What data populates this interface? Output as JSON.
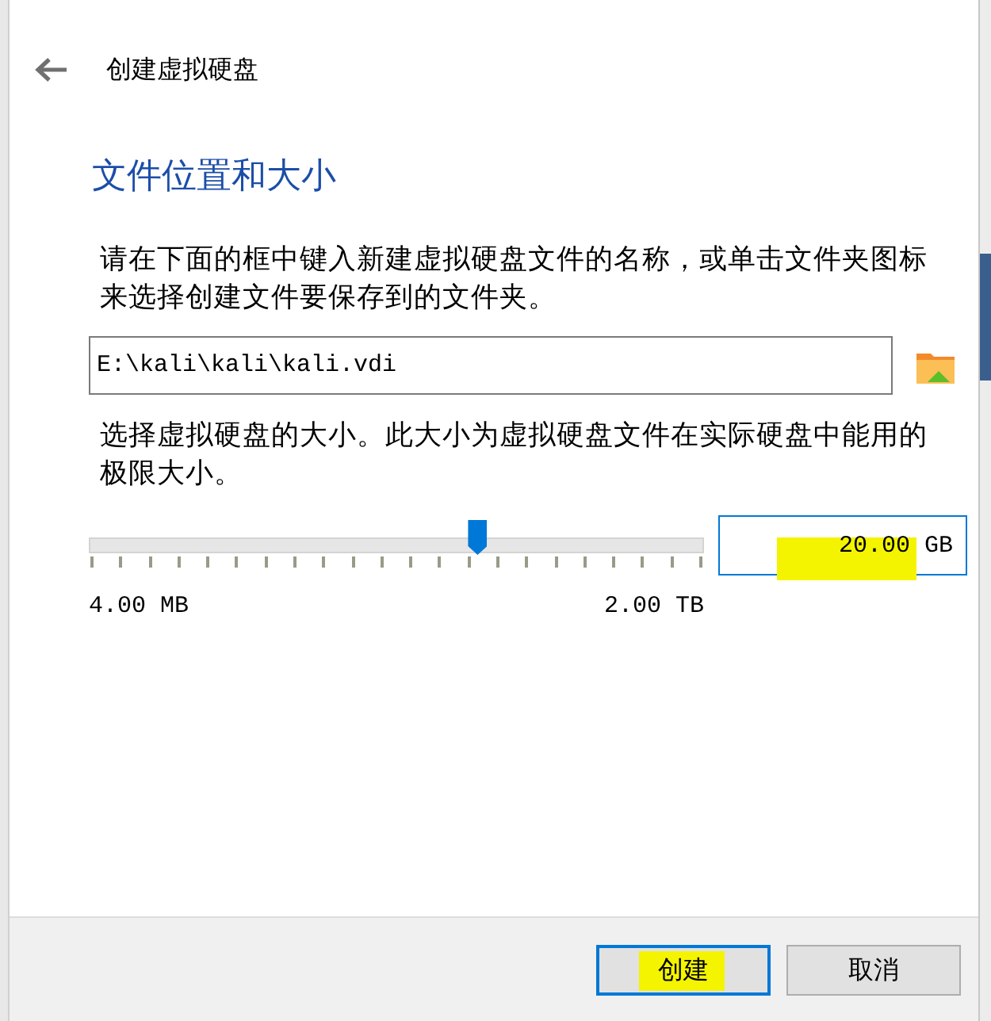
{
  "window": {
    "title": "创建虚拟硬盘"
  },
  "heading": "文件位置和大小",
  "location_hint": "请在下面的框中键入新建虚拟硬盘文件的名称，或单击文件夹图标来选择创建文件要保存到的文件夹。",
  "file_path": {
    "value": "E:\\kali\\kali\\kali.vdi"
  },
  "size_hint": "选择虚拟硬盘的大小。此大小为虚拟硬盘文件在实际硬盘中能用的极限大小。",
  "size_slider": {
    "level": 0.632,
    "min_label": "4.00 MB",
    "max_label": "2.00 TB"
  },
  "size_field": {
    "value": "20.00 GB",
    "highlighted": true
  },
  "buttons": [
    {
      "label": "创建",
      "kind": "primary",
      "highlighted": true
    },
    {
      "label": "取消",
      "kind": "normal",
      "highlighted": false
    }
  ]
}
